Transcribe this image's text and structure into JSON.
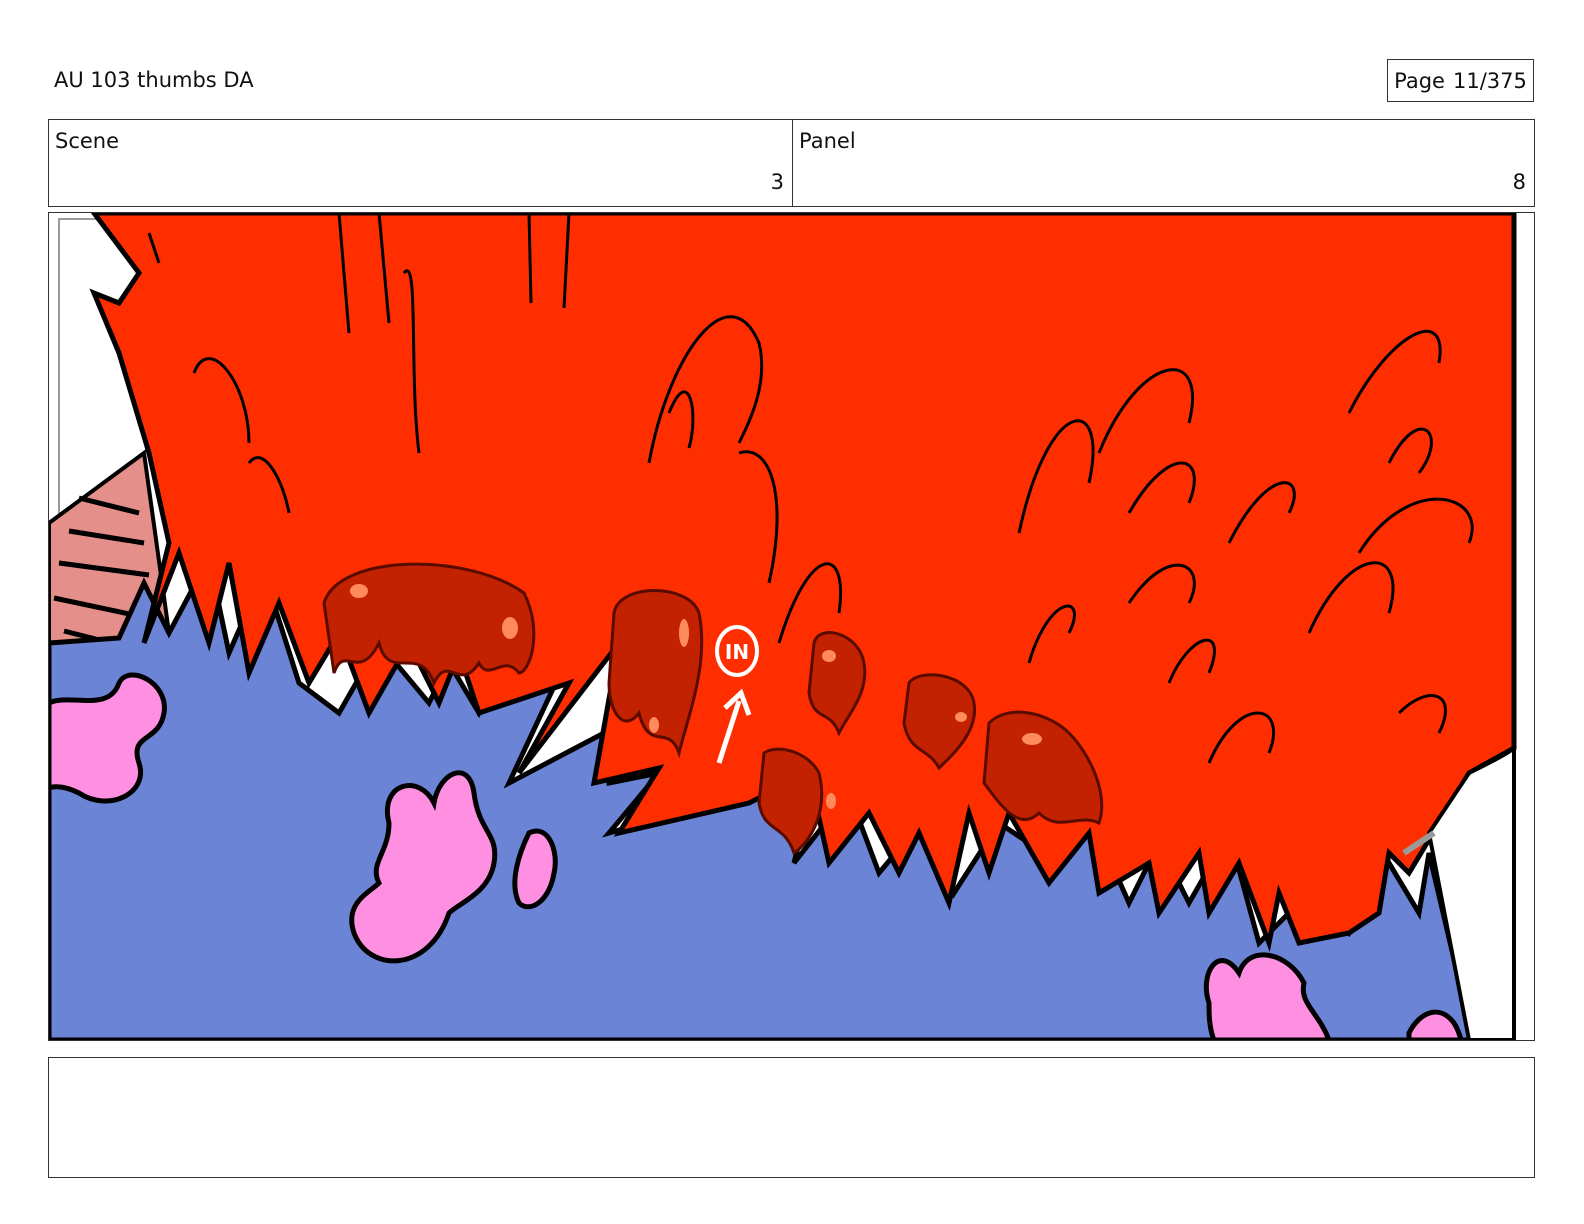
{
  "header": {
    "title": "AU 103 thumbs DA",
    "page_label": "Page",
    "page_number": "11/375"
  },
  "info": {
    "scene_label": "Scene",
    "scene_value": "3",
    "panel_label": "Panel",
    "panel_value": "8"
  },
  "artwork": {
    "annotation_text": "IN",
    "colors": {
      "flame": "#ff2e00",
      "flame_dark": "#c22200",
      "water": "#6b84d6",
      "petal": "#ff8fe0",
      "skin": "#e48f8a"
    }
  },
  "notes": {
    "text": ""
  }
}
